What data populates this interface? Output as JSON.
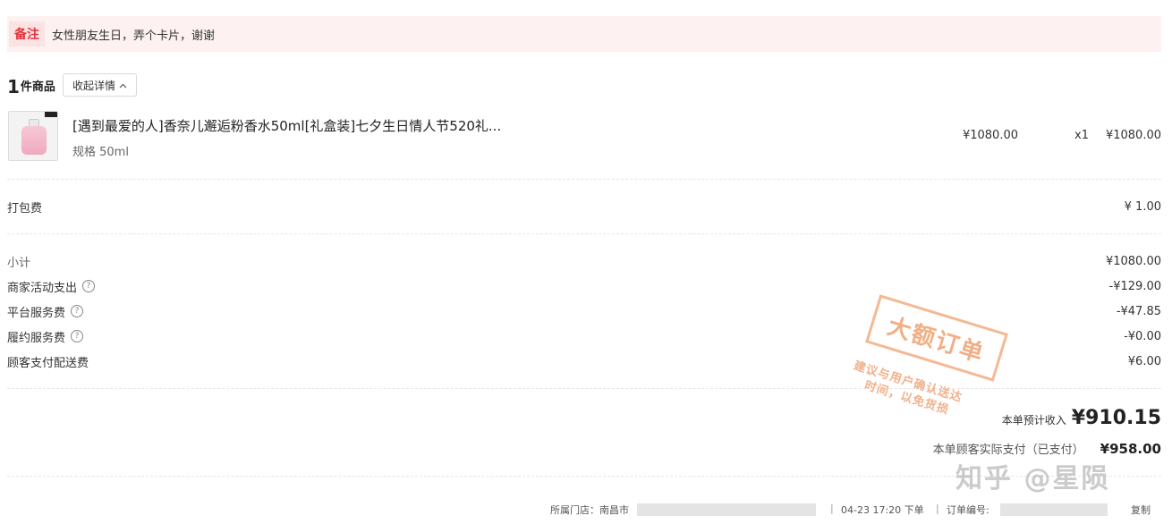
{
  "remark": {
    "label": "备注",
    "text": "女性朋友生日，弄个卡片，谢谢"
  },
  "goods": {
    "count": "1",
    "unit": "件商品",
    "collapse_label": "收起详情",
    "collapse_icon": "chevron-up-icon"
  },
  "product": {
    "title": "[遇到最爱的人]香奈儿邂逅粉香水50ml[礼盒装]七夕生日情人节520礼...",
    "spec": "规格 50ml",
    "unit_price": "¥1080.00",
    "quantity": "x1",
    "total": "¥1080.00"
  },
  "packing": {
    "label": "打包费",
    "value": "¥ 1.00"
  },
  "summary": {
    "subtotal_label": "小计",
    "subtotal_value": "¥1080.00",
    "merchant_label": "商家活动支出",
    "merchant_value": "-¥129.00",
    "platform_label": "平台服务费",
    "platform_value": "-¥47.85",
    "fulfill_label": "履约服务费",
    "fulfill_value": "-¥0.00",
    "delivery_label": "顾客支付配送费",
    "delivery_value": "¥6.00"
  },
  "totals": {
    "income_label": "本单预计收入",
    "income_value": "¥910.15",
    "paid_label": "本单顾客实际支付（已支付）",
    "paid_value": "¥958.00"
  },
  "footer": {
    "store_label": "所属门店：南昌市",
    "sep": "|",
    "time": "04-23 17:20 下单",
    "order_label": "订单编号:",
    "copy_label": "复制"
  },
  "stamp": {
    "title": "大额订单",
    "line1": "建议与用户确认送达",
    "line2": "时间，以免货损"
  },
  "watermark": "知乎 @星陨"
}
